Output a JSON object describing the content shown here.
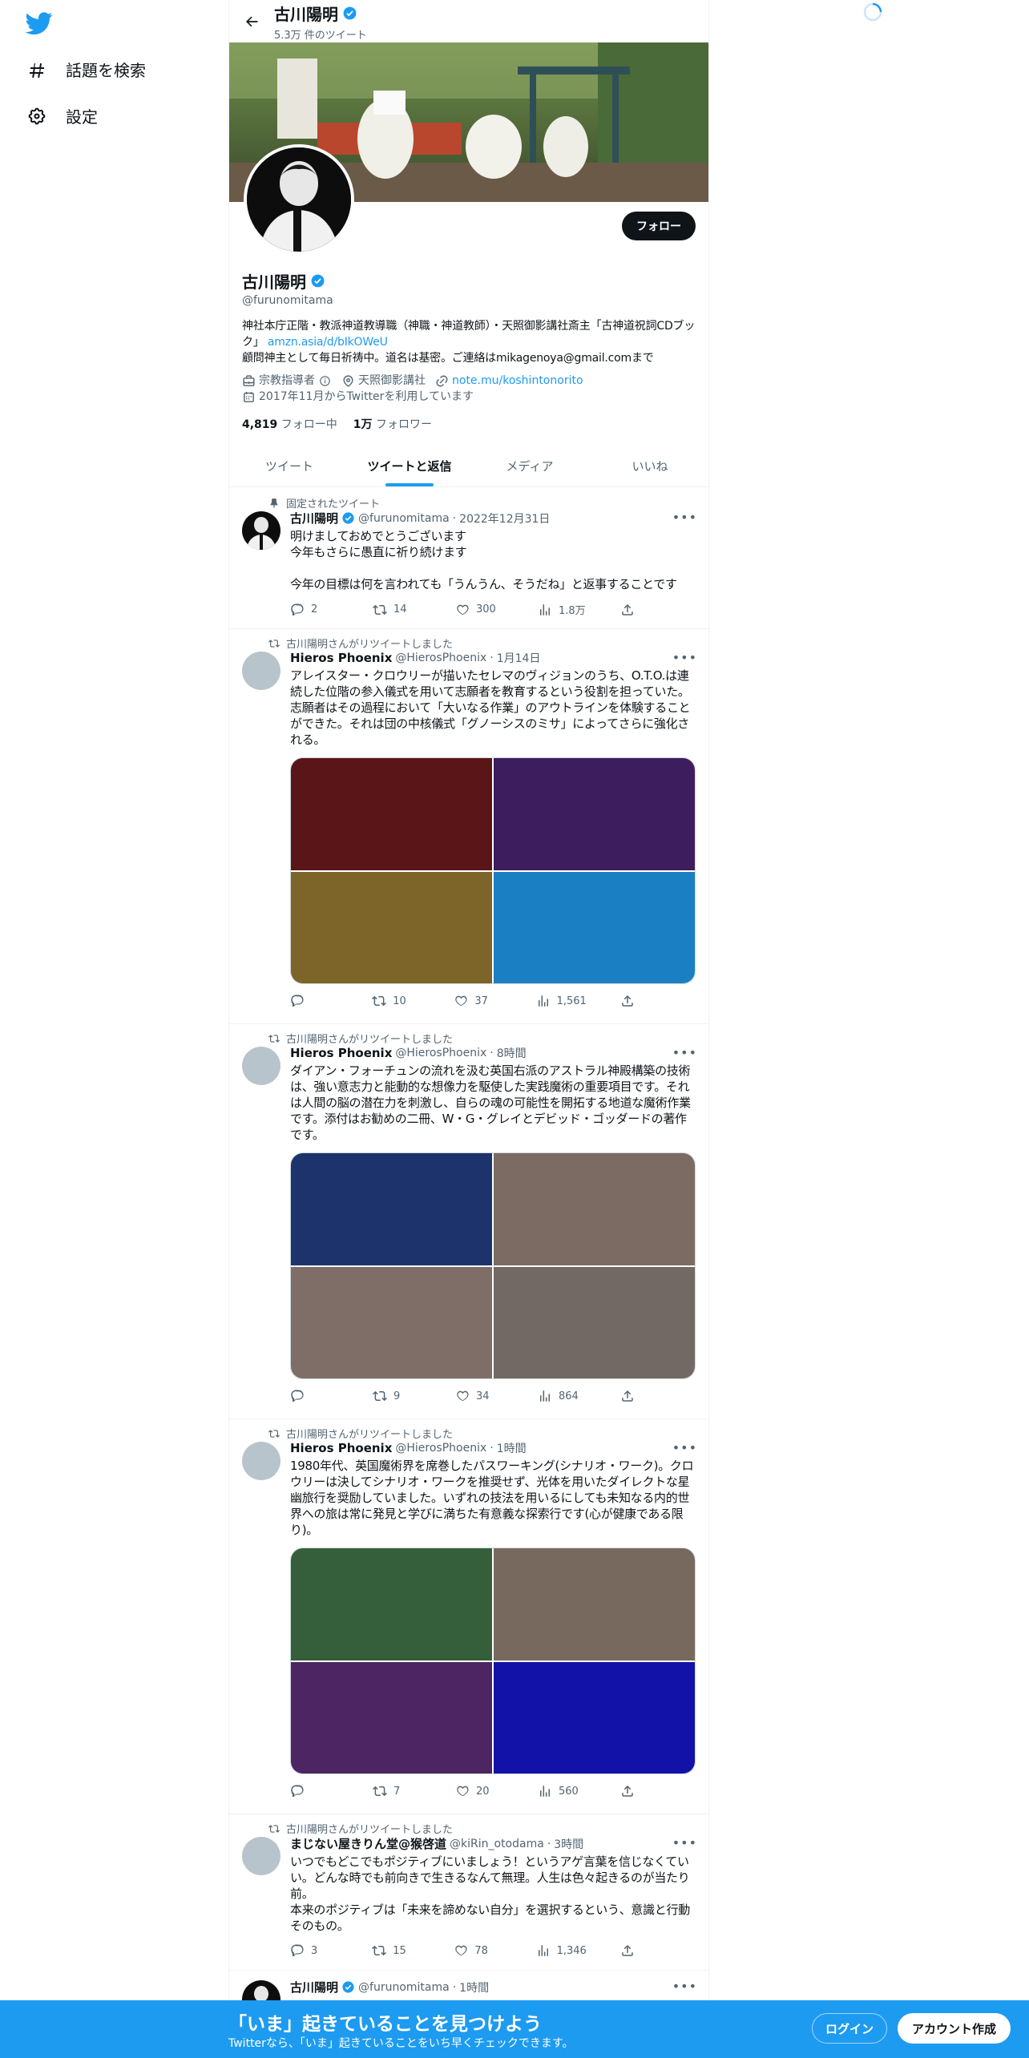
{
  "nav": {
    "explore_label": "話題を検索",
    "settings_label": "設定"
  },
  "header": {
    "name": "古川陽明",
    "tweet_count": "5.3万 件のツイート"
  },
  "profile": {
    "name": "古川陽明",
    "handle": "@furunomitama",
    "follow_label": "フォロー",
    "bio_line1": "神社本庁正階・教派神道教導職（神職・神道教師）・天照御影講社斎主「古神道祝詞CDブック」",
    "bio_link": "amzn.asia/d/bIkOWeU",
    "bio_line2": "顧問神主として毎日祈祷中。道名は基密。ご連絡はmikagenoya@gmail.comまで",
    "category": "宗教指導者",
    "location": "天照御影講社",
    "website": "note.mu/koshintonorito",
    "joined": "2017年11月からTwitterを利用しています",
    "following_count": "4,819",
    "following_label": "フォロー中",
    "followers_count": "1万",
    "followers_label": "フォロワー"
  },
  "tabs": [
    "ツイート",
    "ツイートと返信",
    "メディア",
    "いいね"
  ],
  "active_tab": 1,
  "tweets": [
    {
      "context": "固定されたツイート",
      "name": "古川陽明",
      "handle": "@furunomitama",
      "date": "2022年12月31日",
      "text": "明けましておめでとうございます\n今年もさらに愚直に祈り続けます\n\n今年の目標は何を言われても「うんうん、そうだね」と返事することです",
      "replies": "2",
      "retweets": "14",
      "likes": "300",
      "views": "1.8万"
    },
    {
      "context": "古川陽明さんがリツイートしました",
      "name": "Hieros Phoenix",
      "handle": "@HierosPhoenix",
      "date": "1月14日",
      "text": "アレイスター・クロウリーが描いたセレマのヴィジョンのうち、O.T.O.は連続した位階の参入儀式を用いて志願者を教育するという役割を担っていた。志願者はその過程において「大いなる作業」のアウトラインを体験することができた。それは団の中核儀式「グノーシスのミサ」によってさらに強化される。",
      "replies": "",
      "retweets": "10",
      "likes": "37",
      "views": "1,561",
      "media_colors": [
        "#5a1519",
        "#3e1d5f",
        "#7d6428",
        "#1b7fc4"
      ]
    },
    {
      "context": "古川陽明さんがリツイートしました",
      "name": "Hieros Phoenix",
      "handle": "@HierosPhoenix",
      "date": "8時間",
      "text": "ダイアン・フォーチュンの流れを汲む英国右派のアストラル神殿構築の技術は、強い意志力と能動的な想像力を駆使した実践魔術の重要項目です。それは人間の脳の潜在力を刺激し、自らの魂の可能性を開拓する地道な魔術作業です。添付はお勧めの二冊、W・G・グレイとデビッド・ゴッダードの著作です。",
      "replies": "",
      "retweets": "9",
      "likes": "34",
      "views": "864",
      "media_colors": [
        "#1c336b",
        "#7b6b63",
        "#7e6e67",
        "#736964"
      ]
    },
    {
      "context": "古川陽明さんがリツイートしました",
      "name": "Hieros Phoenix",
      "handle": "@HierosPhoenix",
      "date": "1時間",
      "text": "1980年代、英国魔術界を席巻したパスワーキング(シナリオ・ワーク)。クロウリーは決してシナリオ・ワークを推奨せず、光体を用いたダイレクトな星幽旅行を奨励していました。いずれの技法を用いるにしても未知なる内的世界への旅は常に発見と学びに満ちた有意義な探索行です(心が健康である限り)。",
      "replies": "",
      "retweets": "7",
      "likes": "20",
      "views": "560",
      "media_colors": [
        "#355f3a",
        "#78695f",
        "#4d2563",
        "#1212a8"
      ]
    },
    {
      "context": "古川陽明さんがリツイートしました",
      "name": "まじない屋きりん堂@猴啓道",
      "handle": "@kiRin_otodama",
      "date": "3時間",
      "text": "いつでもどこでもポジティブにいましょう！というアゲ言葉を信じなくていい。どんな時でも前向きで生きるなんて無理。人生は色々起きるのが当たり前。\n本来のポジティブは「未来を諦めない自分」を選択するという、意識と行動そのもの。",
      "replies": "3",
      "retweets": "15",
      "likes": "78",
      "views": "1,346"
    },
    {
      "context": "",
      "name": "古川陽明",
      "handle": "@furunomitama",
      "date": "1時間",
      "text": ""
    }
  ],
  "bottom_bar": {
    "title": "「いま」起きていることを見つけよう",
    "subtitle": "Twitterなら、「いま」起きていることをいち早くチェックできます。",
    "login_label": "ログイン",
    "signup_label": "アカウント作成"
  },
  "colors": {
    "accent": "#1d9bf0",
    "text": "#0f1419",
    "secondary": "#536471",
    "bottom_bar": "#1d9bf0"
  }
}
